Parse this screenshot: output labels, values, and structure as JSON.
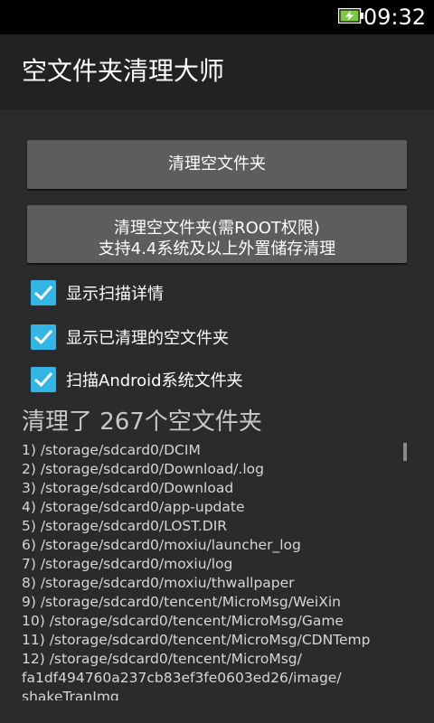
{
  "status_bar": {
    "time": "09:32",
    "battery_icon": "battery-charging-icon",
    "battery_color": "#7ac943"
  },
  "action_bar": {
    "title": "空文件夹清理大师"
  },
  "buttons": {
    "clean": "清理空文件夹",
    "clean_root_line1": "清理空文件夹(需ROOT权限)",
    "clean_root_line2": "支持4.4系统及以上外置储存清理"
  },
  "options": [
    {
      "label": "显示扫描详情",
      "checked": true
    },
    {
      "label": "显示已清理的空文件夹",
      "checked": true
    },
    {
      "label": "扫描Android系统文件夹",
      "checked": true
    }
  ],
  "summary": "清理了 267个空文件夹",
  "log": [
    "1) /storage/sdcard0/DCIM",
    "2) /storage/sdcard0/Download/.log",
    "3) /storage/sdcard0/Download",
    "4) /storage/sdcard0/app-update",
    "5) /storage/sdcard0/LOST.DIR",
    "6) /storage/sdcard0/moxiu/launcher_log",
    "7) /storage/sdcard0/moxiu/log",
    "8) /storage/sdcard0/moxiu/thwallpaper",
    "9) /storage/sdcard0/tencent/MicroMsg/WeiXin",
    "10) /storage/sdcard0/tencent/MicroMsg/Game",
    "11) /storage/sdcard0/tencent/MicroMsg/CDNTemp",
    "12) /storage/sdcard0/tencent/MicroMsg/",
    "fa1df494760a237cb83ef3fe0603ed26/image/",
    "shakeTranImg"
  ],
  "colors": {
    "accent": "#33b5e5",
    "button": "#5d5d5d",
    "background": "#2b2b2b",
    "action_bar": "#222222"
  }
}
